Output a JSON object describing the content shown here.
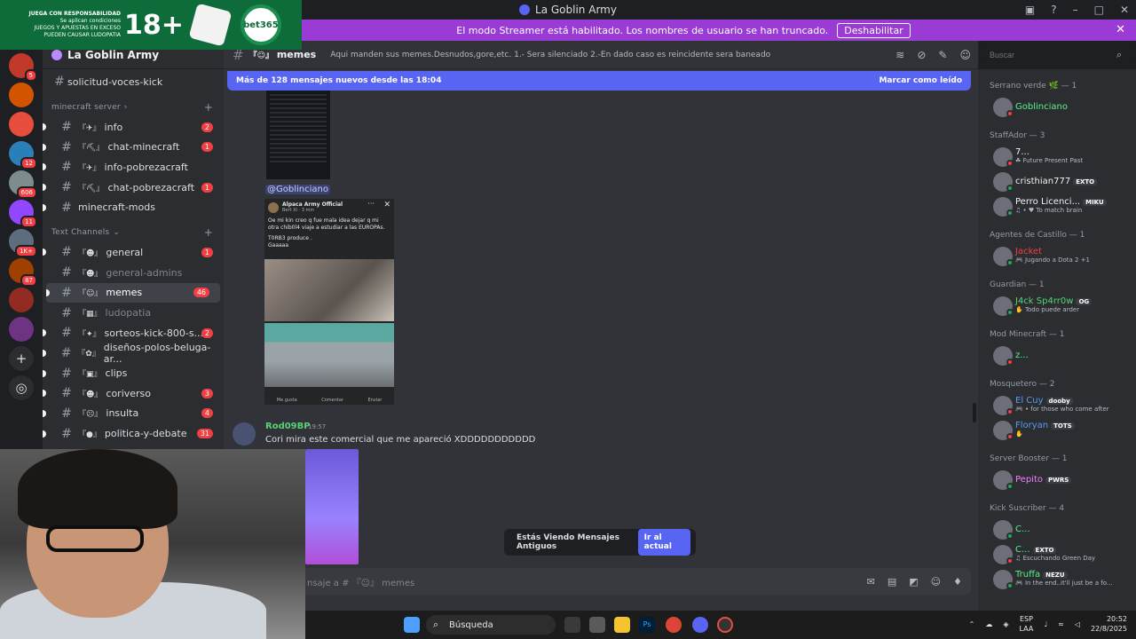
{
  "window": {
    "title": "La Goblin Army"
  },
  "ad": {
    "line1": "JUEGA CON RESPONSABILIDAD",
    "line2": "Se aplican condiciones",
    "line3": "JUEGOS Y APUESTAS EN EXCESO",
    "line4": "PUEDEN CAUSAR LUDOPATIA",
    "age": "18+",
    "brand": "bet365"
  },
  "banner": {
    "text": "El modo Streamer está habilitado. Los nombres de usuario se han truncado.",
    "button": "Deshabilitar"
  },
  "rail": {
    "servers": [
      {
        "badge": "5",
        "color": "#c0392b"
      },
      {
        "badge": "",
        "color": "#d35400"
      },
      {
        "badge": "",
        "color": "#e74c3c"
      },
      {
        "badge": "12",
        "color": "#2980b9"
      },
      {
        "badge": "606",
        "color": "#7f8c8d"
      },
      {
        "badge": "11",
        "color": "#9146ff"
      },
      {
        "badge": "1K+",
        "color": "#5d6d7e"
      },
      {
        "badge": "87",
        "color": "#a04000"
      },
      {
        "badge": "",
        "color": "#922b21"
      },
      {
        "badge": "",
        "color": "#6c3483"
      }
    ]
  },
  "sidebar": {
    "server_name": "La Goblin Army",
    "top_channel": "solicitud-voces-kick",
    "categories": {
      "minecraft": "minecraft server",
      "text": "Text Channels"
    },
    "minecraft_channels": [
      {
        "prefix": "『✈』",
        "name": "info",
        "badge": "2"
      },
      {
        "prefix": "『⛏』",
        "name": "chat-minecraft",
        "badge": "1"
      },
      {
        "prefix": "『✈』",
        "name": "info-pobrezacraft",
        "badge": ""
      },
      {
        "prefix": "『⛏』",
        "name": "chat-pobrezacraft",
        "badge": "1"
      },
      {
        "prefix": "",
        "name": "minecraft-mods",
        "badge": ""
      }
    ],
    "text_channels": [
      {
        "prefix": "『☻』",
        "name": "general",
        "badge": "1",
        "muted": false
      },
      {
        "prefix": "『☻』",
        "name": "general-admins",
        "badge": "",
        "muted": true
      },
      {
        "prefix": "『☺』",
        "name": "memes",
        "badge": "46",
        "muted": false,
        "active": true
      },
      {
        "prefix": "『▦』",
        "name": "ludopatia",
        "badge": "",
        "muted": true
      },
      {
        "prefix": "『✦』",
        "name": "sorteos-kick-800-s...",
        "badge": "2",
        "muted": false
      },
      {
        "prefix": "『✿』",
        "name": "diseños-polos-beluga-ar...",
        "badge": "",
        "muted": false
      },
      {
        "prefix": "『▣』",
        "name": "clips",
        "badge": "",
        "muted": false
      },
      {
        "prefix": "『☻』",
        "name": "coriverso",
        "badge": "3",
        "muted": false
      },
      {
        "prefix": "『☹』",
        "name": "insulta",
        "badge": "4",
        "muted": false
      },
      {
        "prefix": "『●』",
        "name": "politica-y-debate",
        "badge": "31",
        "muted": false
      }
    ]
  },
  "header": {
    "channel_prefix": "『☺』",
    "channel_name": "memes",
    "topic": "Aqui manden sus memes.Desnudos,gore,etc. 1.- Sera silenciado 2.-En dado caso es reincidente sera baneado",
    "search_placeholder": "Buscar"
  },
  "chat": {
    "new_messages": "Más de 128 mensajes nuevos desde las 18:04",
    "mark_read": "Marcar como leído",
    "mention": "@Goblinciano",
    "fb_post": {
      "page": "Alpaca Army Official",
      "meta": "Bert Xi · 3 min",
      "text1": "Oe mi kin creo q fue mala idea dejar q mi otra chib0l4 viaje a estudiar a las EUROPAs.",
      "text2": "T0RB3 produce .",
      "text3": "Gaaaaa",
      "like": "Me gusta",
      "comment": "Comentar",
      "share": "Enviar"
    },
    "message": {
      "author": "Rod09BP",
      "time": "19:57",
      "text": "Cori mira este comercial que me apareció XDDDDDDDDDDD"
    },
    "old_notice": "Estás Viendo Mensajes Antiguos",
    "old_button": "Ir al actual",
    "composer_placeholder": "nsaje a # 『☺』 memes"
  },
  "members": [
    {
      "role": "Serrano verde 🌿 — 1",
      "items": [
        {
          "name": "Goblinciano",
          "color": "#57f287",
          "sub": "",
          "tag": "",
          "status": "#f23f43"
        }
      ]
    },
    {
      "role": "StaffAdor — 3",
      "items": [
        {
          "name": "7...",
          "color": "#f2f3f5",
          "sub": "☘ Future Present Past",
          "tag": "",
          "status": "#f23f43"
        },
        {
          "name": "cristhian777",
          "color": "#f2f3f5",
          "sub": "",
          "tag": "EXTO",
          "status": "#23a55a"
        },
        {
          "name": "Perro Licenci...",
          "color": "#f2f3f5",
          "sub": "♫ • ♥ To match brain",
          "tag": "MIKU",
          "status": "#23a55a"
        }
      ]
    },
    {
      "role": "Agentes de Castillo — 1",
      "items": [
        {
          "name": "Jacket",
          "color": "#f23f43",
          "sub": "🎮 Jugando a Dota 2 +1",
          "tag": "",
          "status": "#23a55a"
        }
      ]
    },
    {
      "role": "Guardian — 1",
      "items": [
        {
          "name": "J4ck Sp4rr0w",
          "color": "#57d477",
          "sub": "✋ Todo puede arder",
          "tag": "OG",
          "status": "#23a55a"
        }
      ]
    },
    {
      "role": "Mod Minecraft — 1",
      "items": [
        {
          "name": "z...",
          "color": "#57f287",
          "sub": "",
          "tag": "",
          "status": "#f23f43"
        }
      ]
    },
    {
      "role": "Mosquetero — 2",
      "items": [
        {
          "name": "El Cuy",
          "color": "#5b9cf6",
          "sub": "🎮 • for those who come after",
          "tag": "dooby",
          "status": "#f23f43"
        },
        {
          "name": "Floryan",
          "color": "#5b9cf6",
          "sub": "✋",
          "tag": "TOTS",
          "status": "#f23f43"
        }
      ]
    },
    {
      "role": "Server Booster — 1",
      "items": [
        {
          "name": "Pepito",
          "color": "#f47fff",
          "sub": "",
          "tag": "PWRS",
          "status": "#23a55a"
        }
      ]
    },
    {
      "role": "Kick Suscriber — 4",
      "items": [
        {
          "name": "C...",
          "color": "#57f287",
          "sub": "",
          "tag": "",
          "status": "#23a55a"
        },
        {
          "name": "C...",
          "color": "#57f287",
          "sub": "♫ Escuchando Green Day",
          "tag": "EXTO",
          "status": "#f23f43"
        },
        {
          "name": "Truffa",
          "color": "#57f287",
          "sub": "🎮 In the end..it'll just be a fo...",
          "tag": "NEZU",
          "status": "#23a55a"
        }
      ]
    }
  ],
  "taskbar": {
    "search": "Búsqueda",
    "lang1": "ESP",
    "lang2": "LAA",
    "time": "20:52",
    "date": "22/8/2025"
  }
}
